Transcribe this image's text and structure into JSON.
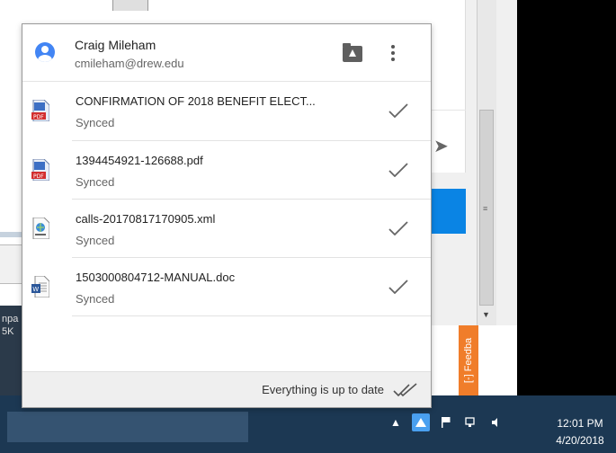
{
  "account": {
    "name": "Craig Mileham",
    "email": "cmileham@drew.edu"
  },
  "files": [
    {
      "name": "CONFIRMATION OF 2018 BENEFIT ELECT...",
      "status": "Synced",
      "type": "pdf"
    },
    {
      "name": "1394454921-126688.pdf",
      "status": "Synced",
      "type": "pdf"
    },
    {
      "name": "calls-20170817170905.xml",
      "status": "Synced",
      "type": "xml"
    },
    {
      "name": "1503000804712-MANUAL.doc",
      "status": "Synced",
      "type": "doc"
    }
  ],
  "footer": {
    "status_text": "Everything is up to date"
  },
  "background": {
    "feedback_label": "[-] Feedba",
    "left_snippet": "npa\n5K",
    "scroll_grip": "≡"
  },
  "taskbar": {
    "time": "12:01 PM",
    "date": "4/20/2018"
  },
  "colors": {
    "accent": "#4285f4",
    "taskbar": "#1c3853",
    "feedback": "#f07d2a",
    "pdf_red": "#d32f2f"
  },
  "icons": {
    "avatar": "account-circle-icon",
    "folder": "drive-folder-icon",
    "more": "more-vert-icon",
    "check": "check-icon",
    "all_done": "double-check-icon"
  }
}
